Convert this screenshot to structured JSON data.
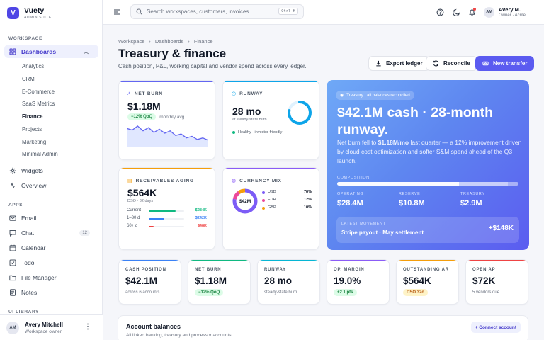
{
  "app": {
    "name": "Vuety",
    "subtitle": "ADMIN SUITE",
    "logo_letter": "V"
  },
  "sidebar": {
    "workspace_label": "WORKSPACE",
    "dashboards_label": "Dashboards",
    "dashboard_items": [
      "Analytics",
      "CRM",
      "E-Commerce",
      "SaaS Metrics",
      "Finance",
      "Projects",
      "Marketing",
      "Minimal Admin"
    ],
    "widgets_label": "Widgets",
    "overview_label": "Overview",
    "apps_label": "APPS",
    "apps": [
      {
        "label": "Email",
        "icon": "mail-icon"
      },
      {
        "label": "Chat",
        "icon": "chat-icon",
        "badge": "12"
      },
      {
        "label": "Calendar",
        "icon": "calendar-icon"
      },
      {
        "label": "Todo",
        "icon": "todo-icon"
      },
      {
        "label": "File Manager",
        "icon": "folder-icon"
      },
      {
        "label": "Notes",
        "icon": "notes-icon"
      }
    ],
    "ui_library_label": "UI LIBRARY",
    "user": {
      "initials": "AM",
      "name": "Avery Mitchell",
      "role": "Workspace owner"
    }
  },
  "topbar": {
    "search_placeholder": "Search workspaces, customers, invoices...",
    "shortcut": "Ctrl K",
    "user": {
      "initials": "AM",
      "name": "Avery M.",
      "role": "Owner · Acme"
    }
  },
  "page": {
    "breadcrumb": [
      "Workspace",
      "Dashboards",
      "Finance"
    ],
    "title": "Treasury & finance",
    "description": "Cash position, P&L, working capital and vendor spend across every ledger.",
    "actions": {
      "export": "Export ledger",
      "reconcile": "Reconcile",
      "new_transfer": "New transfer"
    }
  },
  "net_burn": {
    "label": "NET BURN",
    "value": "$1.18M",
    "delta": "−12% QoQ",
    "note": "monthly avg",
    "trend": [
      24,
      22,
      27,
      21,
      25,
      19,
      23,
      18,
      21,
      15,
      17,
      12,
      14,
      10,
      12,
      9
    ]
  },
  "runway": {
    "label": "RUNWAY",
    "value": "28 mo",
    "note": "at steady-state burn",
    "status": "Healthy · investor-friendly",
    "gauge": 0.78
  },
  "receivables": {
    "label": "RECEIVABLES AGING",
    "value": "$564K",
    "note": "DSO · 32 days",
    "rows": [
      {
        "name": "Current",
        "amount": "$284K",
        "fill": 0.76,
        "color": "#10b981"
      },
      {
        "name": "1–30 d",
        "amount": "$242K",
        "fill": 0.44,
        "color": "#3b82f6"
      },
      {
        "name": "60+ d",
        "amount": "$48K",
        "fill": 0.14,
        "color": "#ef4444"
      }
    ]
  },
  "currency_mix": {
    "label": "CURRENCY MIX",
    "center": "$42M",
    "items": [
      {
        "code": "USD",
        "pct": "78%",
        "value": 78,
        "color": "#7c5cf6"
      },
      {
        "code": "EUR",
        "pct": "12%",
        "value": 12,
        "color": "#ec4899"
      },
      {
        "code": "GBP",
        "pct": "10%",
        "value": 10,
        "color": "#f59e0b"
      }
    ]
  },
  "hero": {
    "badge": "Treasury · all balances reconciled",
    "title": "$42.1M cash · 28-month runway.",
    "text_1": "Net burn fell to ",
    "text_bold": "$1.18M/mo",
    "text_2": " last quarter — a 12% improvement driven by cloud cost optimization and softer S&M spend ahead of the Q3 launch.",
    "composition_label": "COMPOSITION",
    "composition": [
      0.67,
      0.27,
      0.06
    ],
    "accounts": [
      {
        "label": "OPERATING",
        "value": "$28.4M"
      },
      {
        "label": "RESERVE",
        "value": "$10.8M"
      },
      {
        "label": "TREASURY",
        "value": "$2.9M"
      }
    ],
    "movement_label": "LATEST MOVEMENT",
    "movement_text": "Stripe payout · May settlement",
    "movement_value": "+$148K"
  },
  "kpis": [
    {
      "label": "CASH POSITION",
      "value": "$42.1M",
      "sub": "across 6 accounts",
      "color": "#3b82f6",
      "pill": false
    },
    {
      "label": "NET BURN",
      "value": "$1.18M",
      "sub": "−12% QoQ",
      "color": "#10b981",
      "pill": true,
      "pill_bg": "#dcfce7",
      "pill_fg": "#15803d"
    },
    {
      "label": "RUNWAY",
      "value": "28 mo",
      "sub": "steady-state burn",
      "color": "#06b6d4",
      "pill": false
    },
    {
      "label": "OP. MARGIN",
      "value": "19.0%",
      "sub": "+2.1 pts",
      "color": "#8b5cf6",
      "pill": true,
      "pill_bg": "#dcfce7",
      "pill_fg": "#15803d"
    },
    {
      "label": "OUTSTANDING AR",
      "value": "$564K",
      "sub": "DSO 32d",
      "color": "#f59e0b",
      "pill": true,
      "pill_bg": "#fef3c7",
      "pill_fg": "#b45309"
    },
    {
      "label": "OPEN AP",
      "value": "$72K",
      "sub": "5 vendors due",
      "color": "#ef4444",
      "pill": false
    }
  ],
  "accounts_section": {
    "title": "Account balances",
    "subtitle": "All linked banking, treasury and processor accounts",
    "button": "+ Connect account"
  }
}
